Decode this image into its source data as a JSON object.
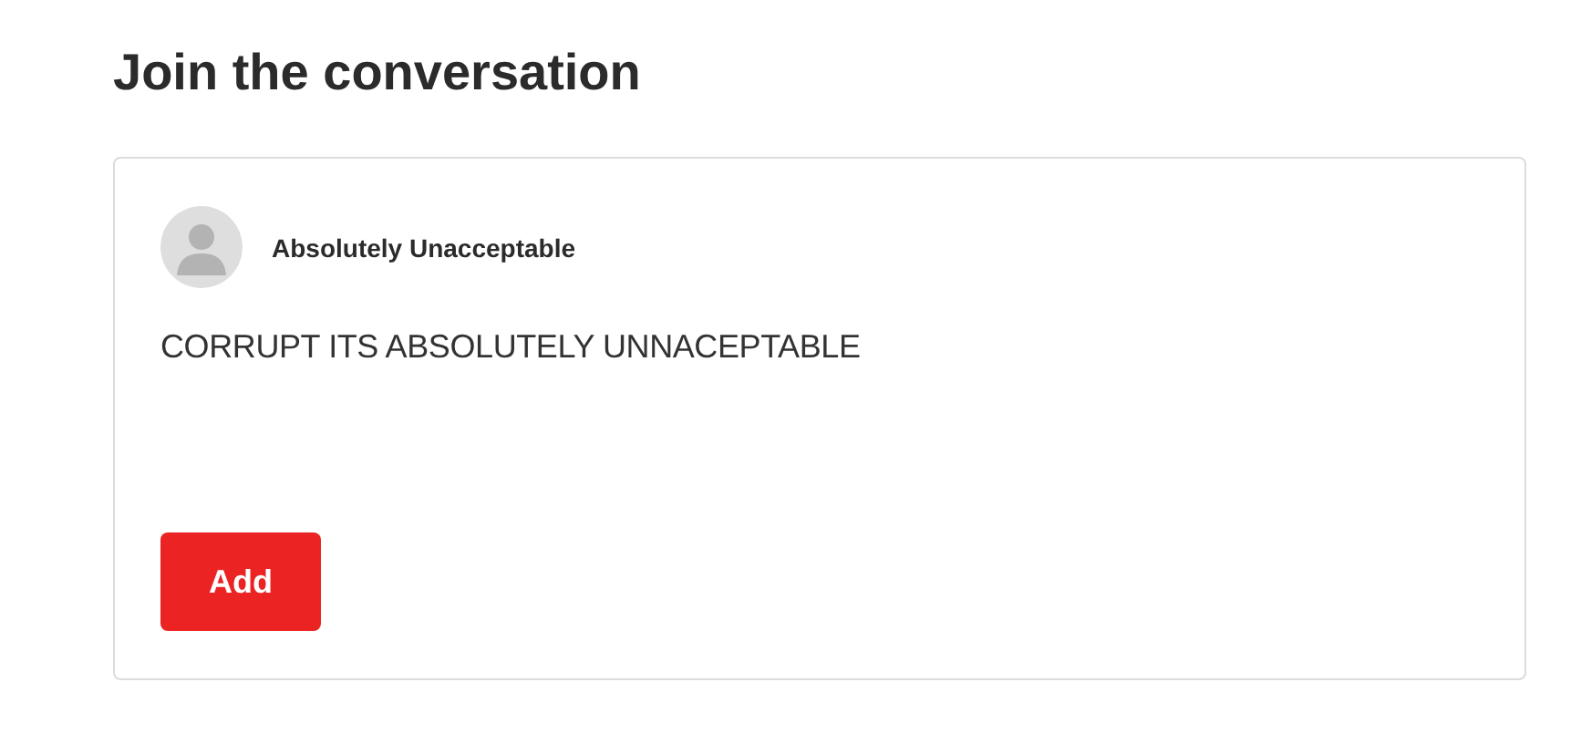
{
  "heading": "Join the conversation",
  "comment_form": {
    "author": "Absolutely Unacceptable",
    "value": "CORRUPT ITS ABSOLUTELY UNNACEPTABLE",
    "button": "Add"
  }
}
